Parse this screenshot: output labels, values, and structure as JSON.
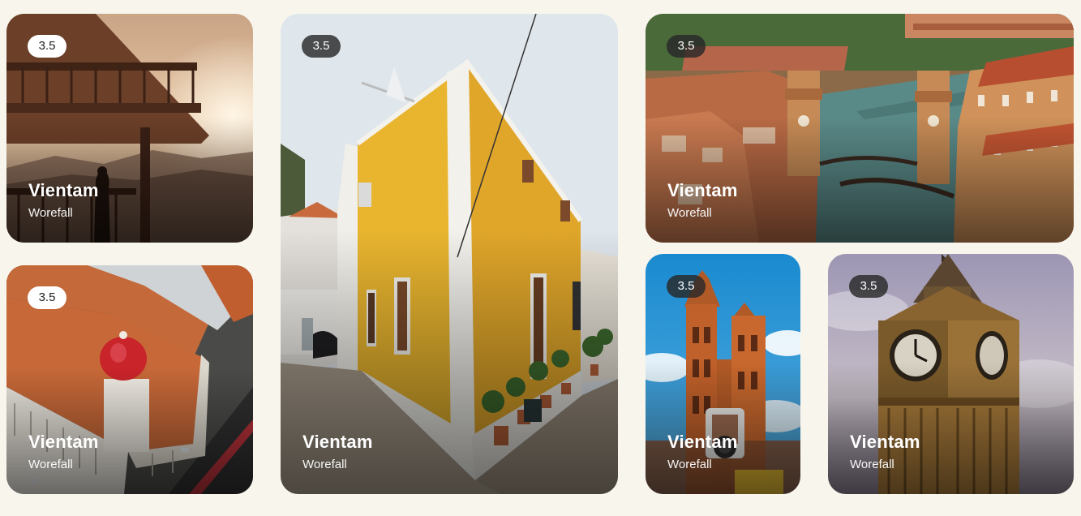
{
  "cards": [
    {
      "rating": "3.5",
      "title": "Vientam",
      "subtitle": "Worefall",
      "image": "balcony-sunset-photo"
    },
    {
      "rating": "3.5",
      "title": "Vientam",
      "subtitle": "Worefall",
      "image": "domed-building-aerial-photo"
    },
    {
      "rating": "3.5",
      "title": "Vientam",
      "subtitle": "Worefall",
      "image": "yellow-house-street-photo"
    },
    {
      "rating": "3.5",
      "title": "Vientam",
      "subtitle": "Worefall",
      "image": "venice-arsenal-canal-photo"
    },
    {
      "rating": "3.5",
      "title": "Vientam",
      "subtitle": "Worefall",
      "image": "gothic-church-towers-photo"
    },
    {
      "rating": "3.5",
      "title": "Vientam",
      "subtitle": "Worefall",
      "image": "big-ben-clock-tower-photo"
    }
  ]
}
